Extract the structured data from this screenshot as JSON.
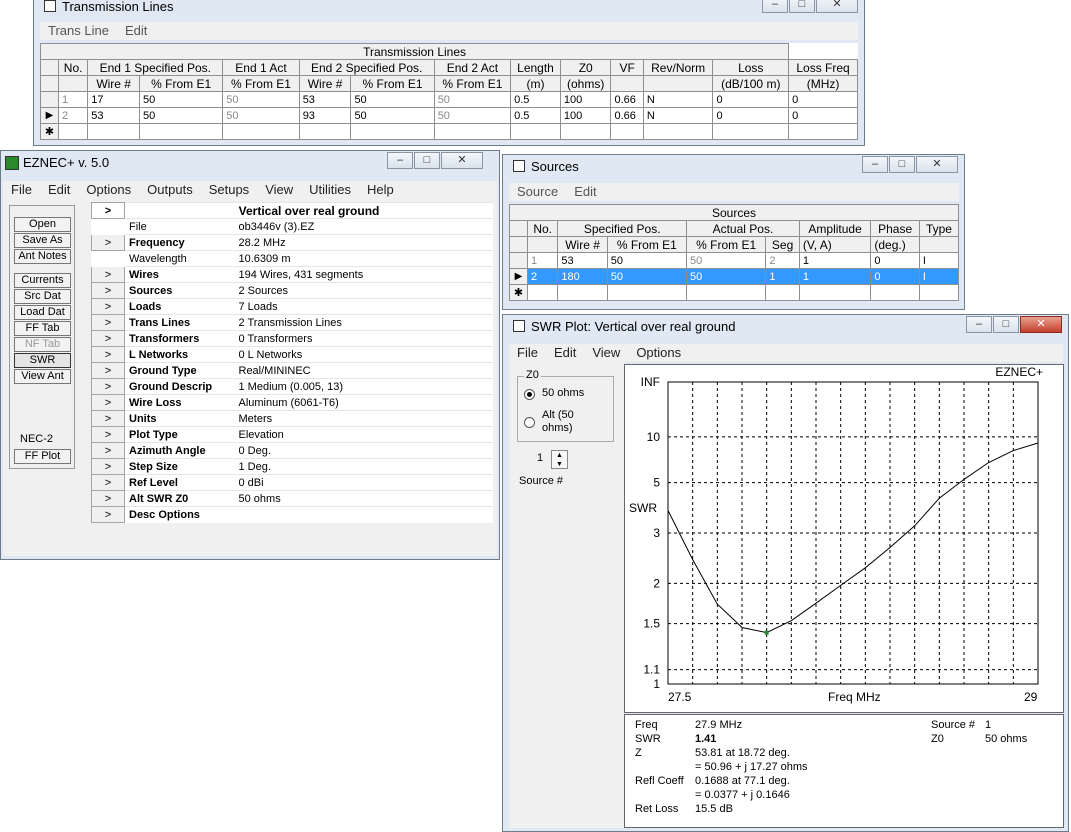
{
  "tl": {
    "title": "Transmission Lines",
    "menu": [
      "Trans Line",
      "Edit"
    ],
    "caption": "Transmission Lines",
    "headers": [
      "No.",
      "End 1 Specified Pos.",
      "End 1 Act",
      "End 2 Specified Pos.",
      "End 2 Act",
      "Length",
      "Z0",
      "VF",
      "Rev/Norm",
      "Loss",
      "Loss Freq"
    ],
    "subheaders": [
      "Wire #",
      "% From E1",
      "% From E1",
      "Wire #",
      "% From E1",
      "% From E1",
      "(m)",
      "(ohms)",
      "",
      "",
      "(dB/100 m)",
      "(MHz)"
    ],
    "rows": [
      [
        "1",
        "17",
        "50",
        "50",
        "53",
        "50",
        "50",
        "0.5",
        "100",
        "0.66",
        "N",
        "0",
        "0"
      ],
      [
        "2",
        "53",
        "50",
        "50",
        "93",
        "50",
        "50",
        "0.5",
        "100",
        "0.66",
        "N",
        "0",
        "0"
      ]
    ]
  },
  "ez": {
    "title": "EZNEC+  v. 5.0",
    "menu": [
      "File",
      "Edit",
      "Options",
      "Outputs",
      "Setups",
      "View",
      "Utilities",
      "Help"
    ],
    "buttons": [
      "Open",
      "Save As",
      "Ant Notes",
      "Currents",
      "Src Dat",
      "Load Dat",
      "FF Tab",
      "NF Tab",
      "SWR",
      "View Ant"
    ],
    "nec_label": "NEC-2",
    "ffplot": "FF Plot",
    "header_arrow": ">",
    "header": "Vertical over real ground",
    "rows": [
      {
        "arrow": "",
        "label": "File",
        "value": "ob3446v (3).EZ"
      },
      {
        "arrow": ">",
        "label": "Frequency",
        "value": "28.2 MHz"
      },
      {
        "arrow": "",
        "label": "Wavelength",
        "value": "10.6309 m"
      },
      {
        "arrow": ">",
        "label": "Wires",
        "value": "194 Wires, 431 segments"
      },
      {
        "arrow": ">",
        "label": "Sources",
        "value": "2 Sources"
      },
      {
        "arrow": ">",
        "label": "Loads",
        "value": "7 Loads"
      },
      {
        "arrow": ">",
        "label": "Trans Lines",
        "value": "2 Transmission Lines"
      },
      {
        "arrow": ">",
        "label": "Transformers",
        "value": "0 Transformers"
      },
      {
        "arrow": ">",
        "label": "L Networks",
        "value": "0 L Networks"
      },
      {
        "arrow": ">",
        "label": "Ground Type",
        "value": "Real/MININEC"
      },
      {
        "arrow": ">",
        "label": "Ground Descrip",
        "value": "1 Medium (0.005, 13)"
      },
      {
        "arrow": ">",
        "label": "Wire Loss",
        "value": "Aluminum (6061-T6)"
      },
      {
        "arrow": ">",
        "label": "Units",
        "value": "Meters"
      },
      {
        "arrow": ">",
        "label": "Plot Type",
        "value": "Elevation"
      },
      {
        "arrow": ">",
        "label": "Azimuth Angle",
        "value": "0 Deg."
      },
      {
        "arrow": ">",
        "label": "Step Size",
        "value": "1 Deg."
      },
      {
        "arrow": ">",
        "label": "Ref Level",
        "value": "0 dBi"
      },
      {
        "arrow": ">",
        "label": "Alt SWR Z0",
        "value": "50 ohms"
      },
      {
        "arrow": ">",
        "label": "Desc Options",
        "value": ""
      }
    ]
  },
  "src": {
    "title": "Sources",
    "menu": [
      "Source",
      "Edit"
    ],
    "caption": "Sources",
    "headers": [
      "No.",
      "Specified Pos.",
      "Actual Pos.",
      "Amplitude",
      "Phase",
      "Type"
    ],
    "subheaders": [
      "Wire #",
      "% From E1",
      "% From E1",
      "Seg",
      "(V, A)",
      "(deg.)"
    ],
    "rows": [
      [
        "1",
        "53",
        "50",
        "50",
        "2",
        "1",
        "0",
        "I"
      ],
      [
        "2",
        "180",
        "50",
        "50",
        "1",
        "1",
        "0",
        "I"
      ]
    ]
  },
  "swr": {
    "title": "SWR Plot: Vertical over real ground",
    "menu": [
      "File",
      "Edit",
      "View",
      "Options"
    ],
    "z0_group": "Z0",
    "opt1": "50 ohms",
    "opt2": "Alt (50 ohms)",
    "source_spin": "1",
    "source_label": "Source #",
    "brand": "EZNEC+",
    "info_left_labels": [
      "Freq",
      "SWR",
      "Z",
      "",
      "Refl Coeff",
      "",
      "Ret Loss"
    ],
    "info_left_values": [
      "27.9 MHz",
      "1.41",
      "53.81 at 18.72 deg.",
      "= 50.96 + j 17.27 ohms",
      "0.1688 at 77.1 deg.",
      "= 0.0377 + j 0.1646",
      "15.5 dB"
    ],
    "info_right_labels": [
      "Source #",
      "Z0"
    ],
    "info_right_values": [
      "1",
      "50 ohms"
    ]
  },
  "chart_data": {
    "type": "line",
    "title": "",
    "xlabel": "Freq MHz",
    "ylabel": "SWR",
    "xlim": [
      27.5,
      29
    ],
    "x_ticks": [
      "27.5",
      "29"
    ],
    "y_ticks": [
      "INF",
      "10",
      "5",
      "3",
      "2",
      "1.5",
      "1.1",
      "1"
    ],
    "y_scale": "reflection-coefficient (SWR)",
    "grid": true,
    "series": [
      {
        "x": [
          27.5,
          27.6,
          27.7,
          27.8,
          27.9,
          28.0,
          28.1,
          28.2,
          28.3,
          28.4,
          28.5,
          28.6,
          28.7,
          28.8,
          28.9,
          29.0
        ],
        "y": [
          3.7,
          2.4,
          1.72,
          1.46,
          1.41,
          1.53,
          1.73,
          1.97,
          2.25,
          2.65,
          3.2,
          4.2,
          5.2,
          6.5,
          7.8,
          8.9
        ]
      }
    ],
    "marker": {
      "x": 27.9,
      "y": 1.41
    }
  }
}
